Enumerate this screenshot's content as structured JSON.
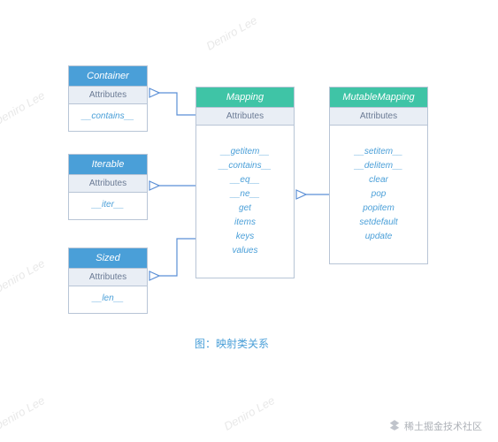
{
  "watermarks": [
    "Deniro Lee",
    "Deniro Lee",
    "Deniro Lee",
    "Deniro Lee",
    "Deniro Lee"
  ],
  "classes": {
    "container": {
      "name": "Container",
      "section": "Attributes",
      "methods": [
        "__contains__"
      ]
    },
    "iterable": {
      "name": "Iterable",
      "section": "Attributes",
      "methods": [
        "__iter__"
      ]
    },
    "sized": {
      "name": "Sized",
      "section": "Attributes",
      "methods": [
        "__len__"
      ]
    },
    "mapping": {
      "name": "Mapping",
      "section": "Attributes",
      "methods": [
        "__getitem__",
        "__contains__",
        "__eq__",
        "__ne__",
        "get",
        "items",
        "keys",
        "values"
      ]
    },
    "mutablemapping": {
      "name": "MutableMapping",
      "section": "Attributes",
      "methods": [
        "__setitem__",
        "__delitem__",
        "clear",
        "pop",
        "popitem",
        "setdefault",
        "update"
      ]
    }
  },
  "caption": "图：映射类关系",
  "credit": "稀土掘金技术社区",
  "colors": {
    "blue": "#4a9fd8",
    "teal": "#3fc4a6",
    "border": "#b8c5d6",
    "arrow": "#5b8fd6"
  }
}
